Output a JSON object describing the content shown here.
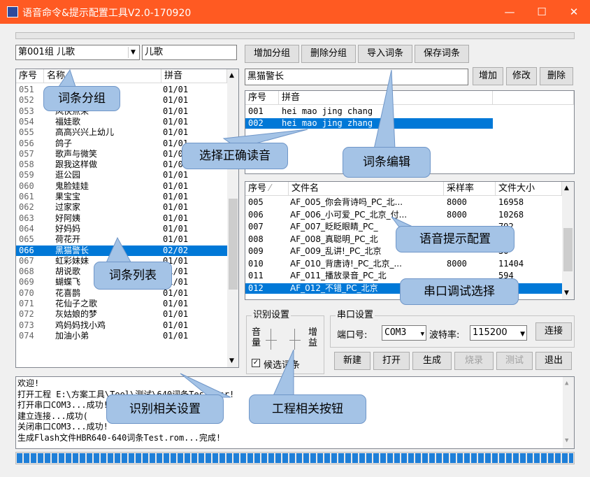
{
  "window": {
    "title": "语音命令&提示配置工具V2.0-170920"
  },
  "group": {
    "selected": "第001组 儿歌",
    "name": "儿歌"
  },
  "toolbar": {
    "add_group": "增加分组",
    "delete_group": "删除分组",
    "import_entries": "导入词条",
    "save_entries": "保存词条"
  },
  "entry_list": {
    "headers": {
      "num": "序号",
      "name": "名称",
      "pinyin": "拼音"
    },
    "rows": [
      {
        "num": "051",
        "name": "",
        "pinyin": "01/01"
      },
      {
        "num": "052",
        "name": "",
        "pinyin": "01/01"
      },
      {
        "num": "053",
        "name": "风快点来",
        "pinyin": "01/01"
      },
      {
        "num": "054",
        "name": "福娃歌",
        "pinyin": "01/01"
      },
      {
        "num": "055",
        "name": "高高兴兴上幼儿",
        "pinyin": "01/01"
      },
      {
        "num": "056",
        "name": "鸽子",
        "pinyin": "01/01"
      },
      {
        "num": "057",
        "name": "歌声与微笑",
        "pinyin": "01/01"
      },
      {
        "num": "058",
        "name": "跟我这样做",
        "pinyin": "01/01"
      },
      {
        "num": "059",
        "name": "逛公园",
        "pinyin": "01/01"
      },
      {
        "num": "060",
        "name": "鬼脸娃娃",
        "pinyin": "01/01"
      },
      {
        "num": "061",
        "name": "果宝宝",
        "pinyin": "01/01"
      },
      {
        "num": "062",
        "name": "过家家",
        "pinyin": "01/01"
      },
      {
        "num": "063",
        "name": "好阿姨",
        "pinyin": "01/01"
      },
      {
        "num": "064",
        "name": "好妈妈",
        "pinyin": "01/01"
      },
      {
        "num": "065",
        "name": "荷花开",
        "pinyin": "01/01"
      },
      {
        "num": "066",
        "name": "黑猫警长",
        "pinyin": "02/02"
      },
      {
        "num": "067",
        "name": "虹彩妹妹",
        "pinyin": "01/01"
      },
      {
        "num": "068",
        "name": "胡说歌",
        "pinyin": "01/01"
      },
      {
        "num": "069",
        "name": "蝴蝶飞",
        "pinyin": "01/01"
      },
      {
        "num": "070",
        "name": "花喜鹊",
        "pinyin": "01/01"
      },
      {
        "num": "071",
        "name": "花仙子之歌",
        "pinyin": "01/01"
      },
      {
        "num": "072",
        "name": "灰姑娘的梦",
        "pinyin": "01/01"
      },
      {
        "num": "073",
        "name": "鸡妈妈找小鸡",
        "pinyin": "01/01"
      },
      {
        "num": "074",
        "name": "加油小弟",
        "pinyin": "01/01"
      }
    ],
    "selected_index": 15
  },
  "entry_edit": {
    "value": "黑猫警长",
    "add": "增加",
    "modify": "修改",
    "delete": "删除"
  },
  "pinyin_list": {
    "headers": {
      "num": "序号",
      "pinyin": "拼音"
    },
    "rows": [
      {
        "num": "001",
        "pinyin": "hei mao jing chang"
      },
      {
        "num": "002",
        "pinyin": "hei mao jing zhang"
      }
    ]
  },
  "file_list": {
    "headers": {
      "num": "序号",
      "name": "文件名",
      "rate": "采样率",
      "size": "文件大小"
    },
    "rows": [
      {
        "num": "005",
        "name": "AF_005_你会背诗吗_PC_北...",
        "rate": "8000",
        "size": "16958"
      },
      {
        "num": "006",
        "name": "AF_006_小可爱_PC_北京_付...",
        "rate": "8000",
        "size": "10268"
      },
      {
        "num": "007",
        "name": "AF_007_眨眨眼睛_PC_",
        "rate": "",
        "size": "792"
      },
      {
        "num": "008",
        "name": "AF_008_真聪明_PC_北",
        "rate": "",
        "size": "540"
      },
      {
        "num": "009",
        "name": "AF_009_乱讲!_PC_北京",
        "rate": "",
        "size": "30"
      },
      {
        "num": "010",
        "name": "AF_010_背唐诗!_PC_北京_...",
        "rate": "8000",
        "size": "11404"
      },
      {
        "num": "011",
        "name": "AF_011_播放录音_PC_北",
        "rate": "",
        "size": "594"
      },
      {
        "num": "012",
        "name": "AF_012_不错_PC_北京",
        "rate": "",
        "size": "8"
      }
    ]
  },
  "recog": {
    "title": "识别设置",
    "volume": "音量",
    "gain": "增益",
    "candidate": "候选词条",
    "candidate_checked": true
  },
  "serial": {
    "title": "串口设置",
    "port_label": "端口号:",
    "port": "COM3",
    "baud_label": "波特率:",
    "baud": "115200",
    "connect": "连接"
  },
  "actions": {
    "new": "新建",
    "open": "打开",
    "generate": "生成",
    "burn": "烧录",
    "test": "测试",
    "exit": "退出"
  },
  "log": [
    "欢迎!",
    "打开工程 E:\\方案工具\\Tool\\测试\\640词条Test.Hsr!",
    "打开串口COM3...成功!",
    "建立连接...成功(",
    "关闭串口COM3...成功!",
    "生成Flash文件HBR640-640词条Test.rom...完成!"
  ],
  "callouts": {
    "entry_group": "词条分组",
    "entry_list": "词条列表",
    "choose_pron": "选择正确读音",
    "entry_edit": "词条编辑",
    "voice_prompt": "语音提示配置",
    "serial_debug": "串口调试选择",
    "recog_settings": "识别相关设置",
    "project_buttons": "工程相关按钮"
  },
  "progress": {
    "value": 1.0
  },
  "colors": {
    "titlebar": "#ff5a22",
    "selection": "#0078d7",
    "callout": "#a4c3e6",
    "progress": "#1e7fd8"
  }
}
